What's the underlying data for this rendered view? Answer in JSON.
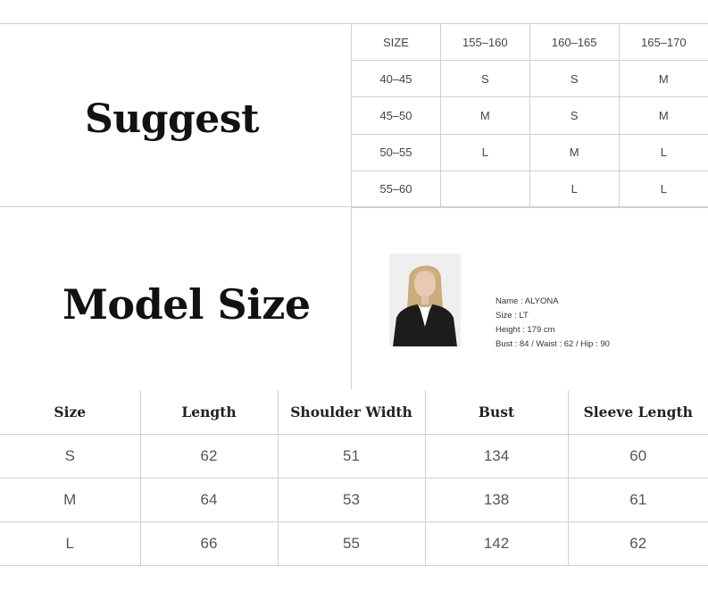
{
  "suggest": {
    "title": "Suggest",
    "header": [
      "SIZE",
      "155–160",
      "160–165",
      "165–170"
    ],
    "rows": [
      [
        "40–45",
        "S",
        "S",
        "M"
      ],
      [
        "45–50",
        "M",
        "S",
        "M"
      ],
      [
        "50–55",
        "L",
        "M",
        "L"
      ],
      [
        "55–60",
        "",
        "L",
        "L"
      ]
    ]
  },
  "model": {
    "title": "Model Size",
    "name": "Name : ALYONA",
    "size": "Size : LT",
    "height": "Height : 179  cm",
    "measurements": "Bust : 84 / Waist : 62 / Hip : 90"
  },
  "measure": {
    "headers": [
      "Size",
      "Length",
      "Shoulder Width",
      "Bust",
      "Sleeve Length"
    ],
    "rows": [
      [
        "S",
        "62",
        "51",
        "134",
        "60"
      ],
      [
        "M",
        "64",
        "53",
        "138",
        "61"
      ],
      [
        "L",
        "66",
        "55",
        "142",
        "62"
      ]
    ]
  }
}
